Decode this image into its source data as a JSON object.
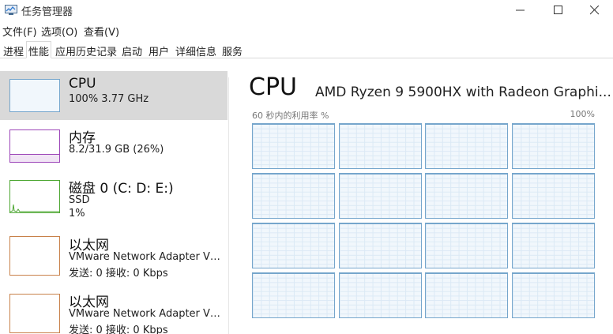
{
  "window": {
    "title": "任务管理器"
  },
  "menu": [
    {
      "label": "文件(F)"
    },
    {
      "label": "选项(O)"
    },
    {
      "label": "查看(V)"
    }
  ],
  "tabs": [
    {
      "label": "进程",
      "active": false
    },
    {
      "label": "性能",
      "active": true
    },
    {
      "label": "应用历史记录",
      "active": false
    },
    {
      "label": "启动",
      "active": false
    },
    {
      "label": "用户",
      "active": false
    },
    {
      "label": "详细信息",
      "active": false
    },
    {
      "label": "服务",
      "active": false
    }
  ],
  "resources": [
    {
      "title": "CPU",
      "line1": "100%  3.77 GHz",
      "line2": "",
      "selected": true,
      "color": "#76a6cc"
    },
    {
      "title": "内存",
      "line1": "8.2/31.9 GB (26%)",
      "line2": "",
      "selected": false,
      "color": "#9c45b8"
    },
    {
      "title": "磁盘 0 (C: D: E:)",
      "line1": "SSD",
      "line2": "1%",
      "selected": false,
      "color": "#4da732"
    },
    {
      "title": "以太网",
      "line1": "VMware Network Adapter VMn...",
      "line2": "发送: 0  接收: 0 Kbps",
      "selected": false,
      "color": "#c8814a"
    },
    {
      "title": "以太网",
      "line1": "VMware Network Adapter VMn...",
      "line2": "发送: 0  接收: 0 Kbps",
      "selected": false,
      "color": "#c8814a"
    }
  ],
  "detail": {
    "title": "CPU",
    "model": "AMD Ryzen 9 5900HX with Radeon Graphi...",
    "graph_label": "60 秒内的利用率 %",
    "graph_max": "100%",
    "core_count": 16,
    "accent": "#76a6cc"
  },
  "icons": {
    "app": "task-manager-icon",
    "minimize": "minimize-icon",
    "maximize": "maximize-icon",
    "close": "close-icon"
  }
}
